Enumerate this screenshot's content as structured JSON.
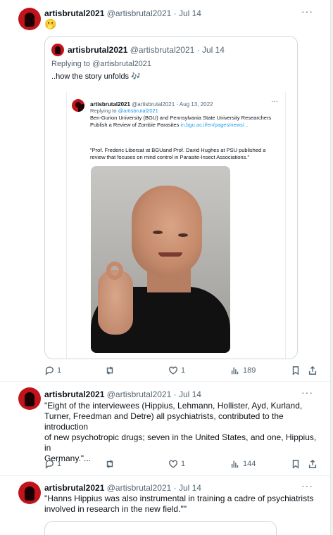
{
  "tweets": [
    {
      "name": "artisbrutal2021",
      "meta": "@artisbrutal2021 · Jul 14",
      "text": "🫢",
      "quote": {
        "name": "artisbrutal2021",
        "meta": "@artisbrutal2021 · Jul 14",
        "reply_to": "Replying to @artisbrutal2021",
        "text": "..how the story unfolds 🎶",
        "inner": {
          "name": "artisbrutal2021",
          "meta": "@artisbrutal2021 · Aug 13, 2022",
          "reply_label": "Replying to ",
          "reply_handle": "@artisbrutal2021",
          "headline": "Ben-Gurion University (BGU) and Pennsylvania State University Researchers Publish a Review of Zombie Parasites ",
          "link": "in.bgu.ac.il/en/pages/news/...",
          "quote_text": "\"Prof. Frederic Libersat at BGUand Prof. David Hughes  at PSU published a review that focuses on mind control in Parasite-Insect Associations.\""
        }
      },
      "actions": {
        "reply": "1",
        "retweet": "",
        "like": "1",
        "views": "189"
      }
    },
    {
      "name": "artisbrutal2021",
      "meta": "@artisbrutal2021 · Jul 14",
      "text_lines": [
        "\"Eight of the interviewees (Hippius, Lehmann, Hollister, Ayd, Kurland,",
        "Turner, Freedman and Detre) all psychiatrists, contributed to the",
        "introduction",
        "of new psychotropic drugs; seven in the United States, and one, Hippius, in",
        "Germany.\"..."
      ],
      "actions": {
        "reply": "1",
        "retweet": "",
        "like": "1",
        "views": "144"
      }
    },
    {
      "name": "artisbrutal2021",
      "meta": "@artisbrutal2021 · Jul 14",
      "text_lines": [
        "\"Hanns Hippius was also instrumental in training a cadre of psychiatrists",
        "involved in research in the new field.\"\""
      ]
    }
  ],
  "more_label": "···",
  "icons": [
    "reply-icon",
    "retweet-icon",
    "like-icon",
    "views-icon",
    "bookmark-icon",
    "share-icon"
  ]
}
